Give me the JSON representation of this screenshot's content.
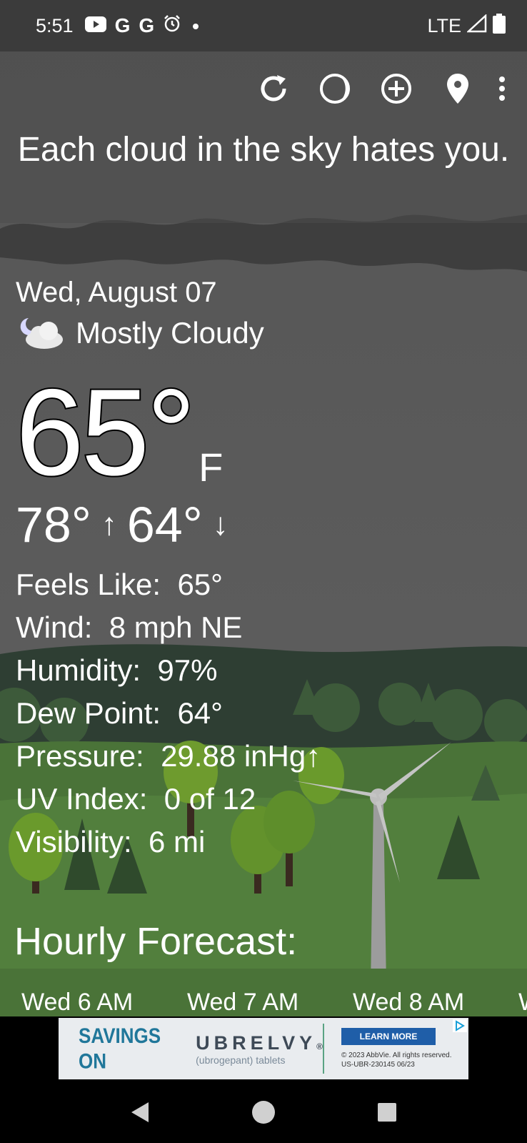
{
  "status_bar": {
    "time": "5:51",
    "notification_icons": [
      "youtube-icon",
      "google-icon",
      "google-icon",
      "alarm-icon",
      "dot-icon"
    ],
    "google_glyph": "G",
    "network": "LTE",
    "right_icons": [
      "signal-icon",
      "battery-icon"
    ]
  },
  "toolbar": {
    "buttons": [
      "refresh-icon",
      "moon-phase-icon",
      "add-location-icon",
      "location-pin-icon",
      "more-options-icon"
    ]
  },
  "quote": "Each cloud in the sky hates you.",
  "current": {
    "date": "Wed, August 07",
    "condition": "Mostly Cloudy",
    "condition_icon": "partly-cloudy-night-icon",
    "temperature": "65°",
    "unit": "F",
    "high": "78°",
    "low": "64°",
    "high_arrow": "↑",
    "low_arrow": "↓"
  },
  "details": [
    {
      "label": "Feels Like:",
      "value": "65°"
    },
    {
      "label": "Wind:",
      "value": "8 mph NE"
    },
    {
      "label": "Humidity:",
      "value": "97%"
    },
    {
      "label": "Dew Point:",
      "value": "64°"
    },
    {
      "label": "Pressure:",
      "value": "29.88 inHg↑"
    },
    {
      "label": "UV Index:",
      "value": "0 of 12"
    },
    {
      "label": "Visibility:",
      "value": "6 mi"
    }
  ],
  "hourly": {
    "title": "Hourly Forecast:",
    "hours": [
      "Wed 6 AM",
      "Wed 7 AM",
      "Wed 8 AM",
      "W"
    ]
  },
  "ad": {
    "headline": "SAVINGS ON",
    "brand": "UBRELVY",
    "brand_trademark": "®",
    "brand_sub": "(ubrogepant) tablets",
    "cta": "LEARN MORE",
    "legal_line1": "© 2023 AbbVie. All rights reserved.",
    "legal_line2": "US-UBR-230145 06/23",
    "colors": {
      "headline": "#20779a",
      "cta": "#1f5ea8",
      "divider": "#5aa383"
    }
  },
  "nav_bar": {
    "buttons": [
      "back-icon",
      "home-icon",
      "recents-icon"
    ]
  },
  "colors": {
    "status_bar": "#3b3b3b",
    "sky": "#555555",
    "hills_dark": "#2e3e33",
    "grass": "#4f7d3e",
    "tree": "#5a8b3a"
  }
}
